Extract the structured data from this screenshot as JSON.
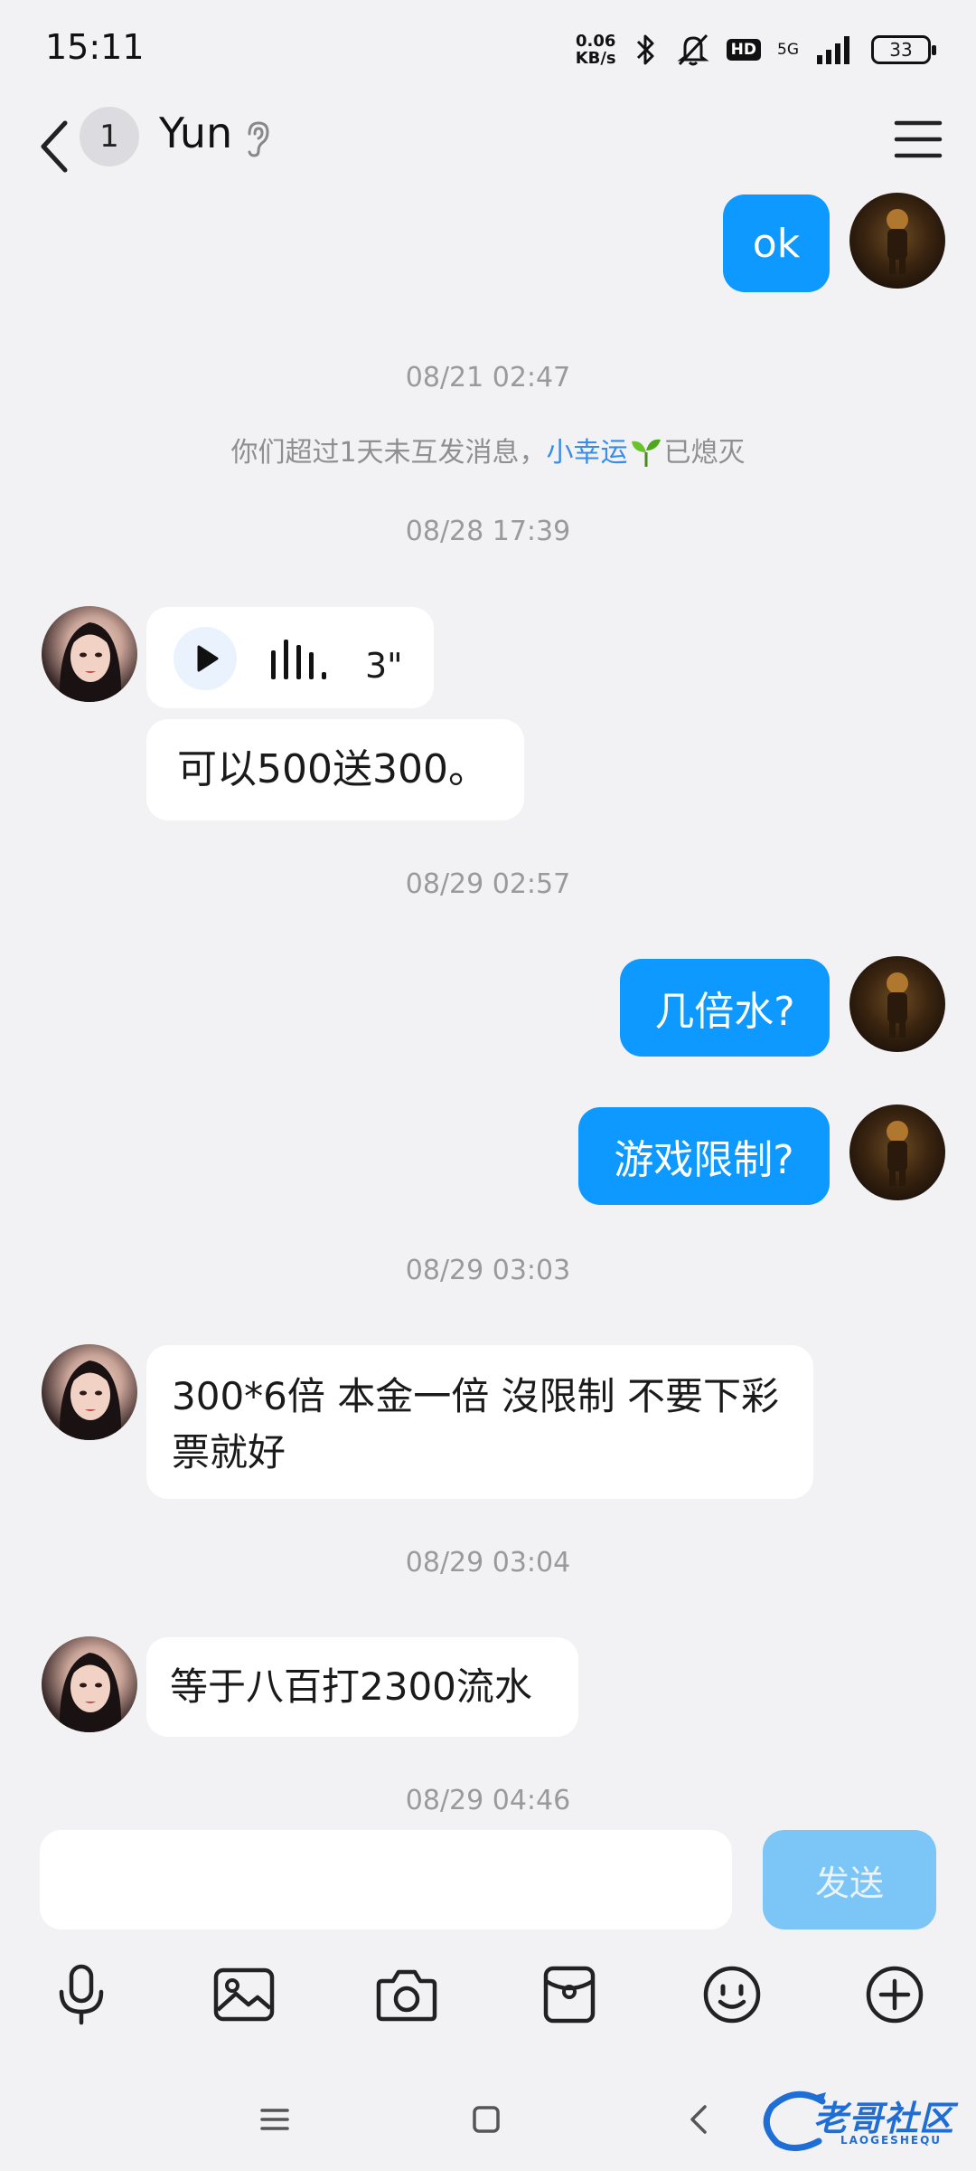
{
  "status_bar": {
    "time": "15:11",
    "net_speed": "0.06",
    "net_unit": "KB/s",
    "hd": "HD",
    "network": "5G",
    "battery": "33"
  },
  "header": {
    "unread_count": "1",
    "title": "Yun"
  },
  "messages": {
    "m1_text": "ok",
    "ts1": "08/21 02:47",
    "sys_prefix": "你们超过1天未互发消息，",
    "sys_highlight": "小幸运",
    "sys_suffix": "已熄灭",
    "ts2": "08/28 17:39",
    "voice_duration": "3\"",
    "m3_text": "可以500送300。",
    "ts3": "08/29 02:57",
    "m4_text": "几倍水?",
    "m5_text": "游戏限制?",
    "ts4": "08/29 03:03",
    "m6_text": "300*6倍 本金一倍 沒限制 不要下彩票就好",
    "ts5": "08/29 03:04",
    "m7_text": "等于八百打2300流水",
    "ts6": "08/29 04:46"
  },
  "composer": {
    "input_value": "",
    "send_label": "发送"
  },
  "watermark": {
    "text": "老哥社区",
    "sub": "LAOGESHEQU"
  },
  "colors": {
    "outgoing_bubble": "#0d99ff",
    "incoming_bubble": "#ffffff",
    "background": "#f2f2f4",
    "link": "#3b8ce8",
    "send_disabled": "#7cc5f7"
  }
}
